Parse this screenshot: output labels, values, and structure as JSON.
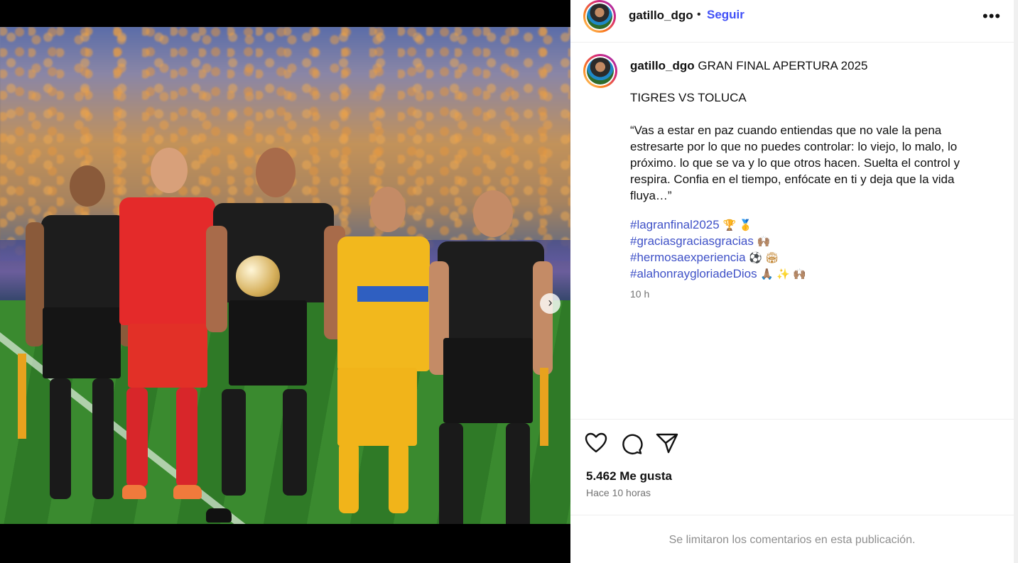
{
  "post": {
    "username": "gatillo_dgo",
    "follow_label": "Seguir",
    "more_icon": "more-options-icon",
    "caption_title": "GRAN FINAL APERTURA 2025",
    "matchup": "TIGRES VS TOLUCA",
    "quote": "“Vas a estar en paz cuando entiendas que no vale la pena estresarte por lo que no puedes controlar: lo viejo, lo malo, lo próximo. lo que se va y lo que otros hacen. Suelta el control y respira. Confia en el tiempo, enfócate en ti y deja que la vida fluya…”",
    "hashtags": [
      {
        "text": "#lagranfinal2025",
        "emoji": "🏆 🥇"
      },
      {
        "text": "#graciasgraciasgracias",
        "emoji": "🙌🏽"
      },
      {
        "text": "#hermosaexperiencia",
        "emoji": "⚽ 🏟"
      },
      {
        "text": "#alahonraygloriadeDios",
        "emoji": "🙏🏽 ✨ 🙌🏽"
      }
    ],
    "caption_time": "10 h",
    "likes": "5.462 Me gusta",
    "posted_ago": "Hace 10 horas",
    "comments_disabled": "Se limitaron los comentarios en esta publicación."
  },
  "carousel": {
    "next_icon": "chevron-right-icon",
    "dots": 4,
    "active_index": 0
  },
  "colors": {
    "link": "#4150f7",
    "hashtag": "#3f51c7",
    "muted": "#737373"
  }
}
